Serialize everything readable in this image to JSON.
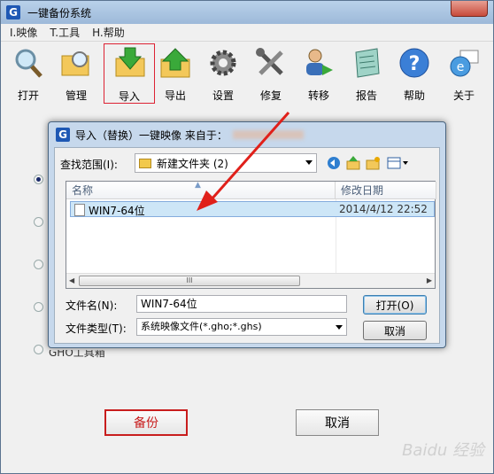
{
  "window": {
    "title": "一键备份系统",
    "logo": "G"
  },
  "menu": [
    "I.映像",
    "T.工具",
    "H.帮助"
  ],
  "toolbar": {
    "items": [
      {
        "label": "打开",
        "icon": "magnifier-open-icon"
      },
      {
        "label": "管理",
        "icon": "folder-search-icon"
      },
      {
        "label": "导入",
        "icon": "import-folder-icon"
      },
      {
        "label": "导出",
        "icon": "export-folder-icon"
      },
      {
        "label": "设置",
        "icon": "gear-icon"
      },
      {
        "label": "修复",
        "icon": "tools-icon"
      },
      {
        "label": "转移",
        "icon": "user-transfer-icon"
      },
      {
        "label": "报告",
        "icon": "notebook-icon"
      },
      {
        "label": "帮助",
        "icon": "help-icon"
      },
      {
        "label": "关于",
        "icon": "about-ie-icon"
      }
    ],
    "selected": "导入"
  },
  "options": {
    "partial_label": "GHO工具箱"
  },
  "buttons": {
    "backup": "备份",
    "cancel": "取消"
  },
  "dialog": {
    "title": "导入（替换）一键映像 来自于：",
    "lookin_label": "查找范围(I):",
    "lookin_value": "新建文件夹 (2)",
    "columns": {
      "name": "名称",
      "modified": "修改日期"
    },
    "files": [
      {
        "name": "WIN7-64位",
        "modified": "2014/4/12 22:52"
      }
    ],
    "scroll_grip": "III",
    "filename_label": "文件名(N):",
    "filename_value": "WIN7-64位",
    "filetype_label": "文件类型(T):",
    "filetype_value": "系统映像文件(*.gho;*.ghs)",
    "open_button": "打开(O)",
    "cancel_button": "取消"
  },
  "watermark": "Baidu 经验",
  "colors": {
    "highlight_red": "#c81d1d",
    "arrow_red": "#e0201a",
    "selection_blue": "#cde6f7"
  }
}
